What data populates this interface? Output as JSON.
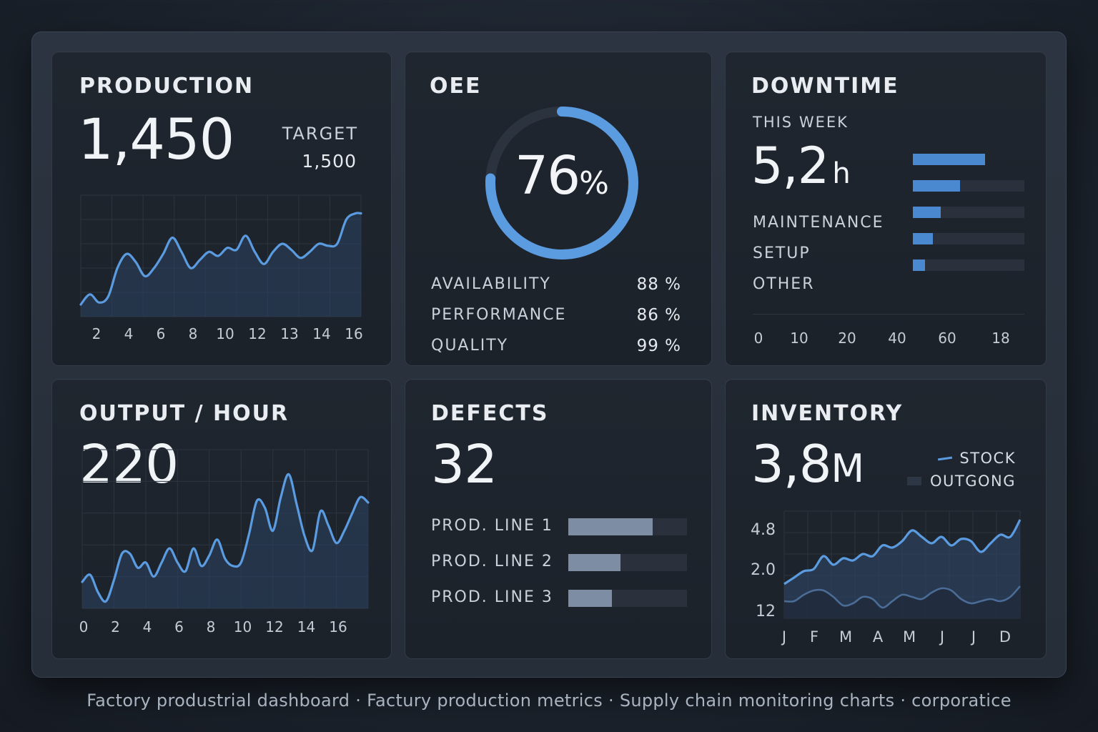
{
  "production": {
    "title": "PRODUCTION",
    "value": "1,450",
    "target_label": "TARGET",
    "target_value": "1,500"
  },
  "oee": {
    "title": "OEE",
    "value": "76",
    "unit": "%",
    "rows": [
      {
        "label": "AVAILABILITY",
        "value": "88 %"
      },
      {
        "label": "PERFORMANCE",
        "value": "86 %"
      },
      {
        "label": "QUALITY",
        "value": "99 %"
      }
    ]
  },
  "downtime": {
    "title": "DOWNTIME",
    "period": "THIS WEEK",
    "value": "5,2",
    "unit": "h",
    "categories": [
      "MAINTENANCE",
      "SETUP",
      "OTHER"
    ]
  },
  "output": {
    "title": "OUTPUT / HOUR",
    "value": "220"
  },
  "defects": {
    "title": "DEFECTS",
    "value": "32"
  },
  "inventory": {
    "title": "INVENTORY",
    "value": "3,8",
    "unit": "M",
    "legend": [
      "STOCK",
      "OUTGONG"
    ]
  },
  "footer": "Factory produstrial dashboard  ·  Factury production metrics  ·  Supply chain monitoring charts  ·  corporatice",
  "colors": {
    "accent": "#5b9be0",
    "fill": "#2c4462",
    "track": "#2a313c",
    "defect_bar": "#7d8ea4"
  },
  "chart_data": [
    {
      "type": "area",
      "x_tick_labels": [
        "2",
        "4",
        "6",
        "8",
        "10",
        "12",
        "13",
        "14",
        "16"
      ],
      "x": [
        1,
        1.5,
        2,
        2.5,
        3,
        3.5,
        4,
        4.5,
        5,
        5.5,
        6,
        6.5,
        7,
        7.5,
        8,
        8.5,
        9,
        9.5,
        10,
        10.5,
        11,
        11.5,
        12,
        12.5,
        13,
        13.5,
        14,
        14.5,
        15,
        15.5,
        16,
        16.3
      ],
      "values": [
        12,
        22,
        14,
        20,
        48,
        62,
        54,
        40,
        48,
        62,
        78,
        64,
        48,
        56,
        64,
        60,
        68,
        66,
        80,
        64,
        52,
        64,
        72,
        66,
        58,
        64,
        72,
        70,
        72,
        96,
        102,
        102
      ],
      "ylim": [
        0,
        120
      ],
      "grid": true
    },
    {
      "type": "area",
      "x_tick_labels": [
        "0",
        "2",
        "4",
        "6",
        "8",
        "10",
        "12",
        "14",
        "16"
      ],
      "x": [
        0,
        0.5,
        1,
        1.5,
        2,
        2.5,
        3,
        3.5,
        4,
        4.5,
        5,
        5.5,
        6,
        6.5,
        7,
        7.5,
        8,
        8.5,
        9,
        9.5,
        10,
        10.5,
        11,
        11.5,
        12,
        12.5,
        13,
        13.5,
        14,
        14.5,
        15,
        15.5,
        16,
        16.5,
        17,
        17.5,
        18
      ],
      "values": [
        30,
        38,
        18,
        8,
        32,
        62,
        62,
        46,
        52,
        36,
        52,
        68,
        52,
        42,
        68,
        48,
        60,
        78,
        56,
        48,
        52,
        84,
        122,
        114,
        88,
        126,
        152,
        118,
        82,
        66,
        110,
        94,
        74,
        88,
        108,
        126,
        120
      ],
      "ylim": [
        0,
        180
      ],
      "grid": true
    },
    {
      "type": "bar",
      "orientation": "horizontal",
      "x_tick_labels": [
        "0",
        "10",
        "20",
        "40",
        "60",
        "18"
      ],
      "values": [
        0.65,
        0.42,
        0.25,
        0.18,
        0.11
      ],
      "grid": false
    },
    {
      "type": "bar",
      "orientation": "horizontal",
      "categories": [
        "PROD. LINE 1",
        "PROD. LINE 2",
        "PROD. LINE 3"
      ],
      "values": [
        0.71,
        0.44,
        0.37
      ]
    },
    {
      "type": "line",
      "x_tick_labels": [
        "J",
        "F",
        "M",
        "A",
        "M",
        "J",
        "J",
        "D"
      ],
      "y_tick_labels": [
        "4.8",
        "2.0",
        "12"
      ],
      "series": [
        {
          "name": "STOCK",
          "values": [
            1.6,
            1.9,
            2.2,
            2.3,
            2.9,
            2.5,
            2.8,
            2.7,
            3.0,
            2.9,
            3.4,
            3.3,
            3.6,
            4.1,
            3.8,
            3.5,
            3.8,
            3.4,
            3.7,
            3.6,
            3.1,
            3.5,
            3.9,
            3.8,
            4.6
          ]
        },
        {
          "name": "OUTGONG",
          "values": [
            0.8,
            0.8,
            1.1,
            1.3,
            1.3,
            1.0,
            0.6,
            0.7,
            1.0,
            0.9,
            0.5,
            0.8,
            1.1,
            1.0,
            0.9,
            1.2,
            1.4,
            1.3,
            0.9,
            0.7,
            0.8,
            0.9,
            0.8,
            1.0,
            1.5
          ]
        }
      ],
      "ylim": [
        0,
        5
      ],
      "legend": "top-right",
      "grid": true
    }
  ]
}
